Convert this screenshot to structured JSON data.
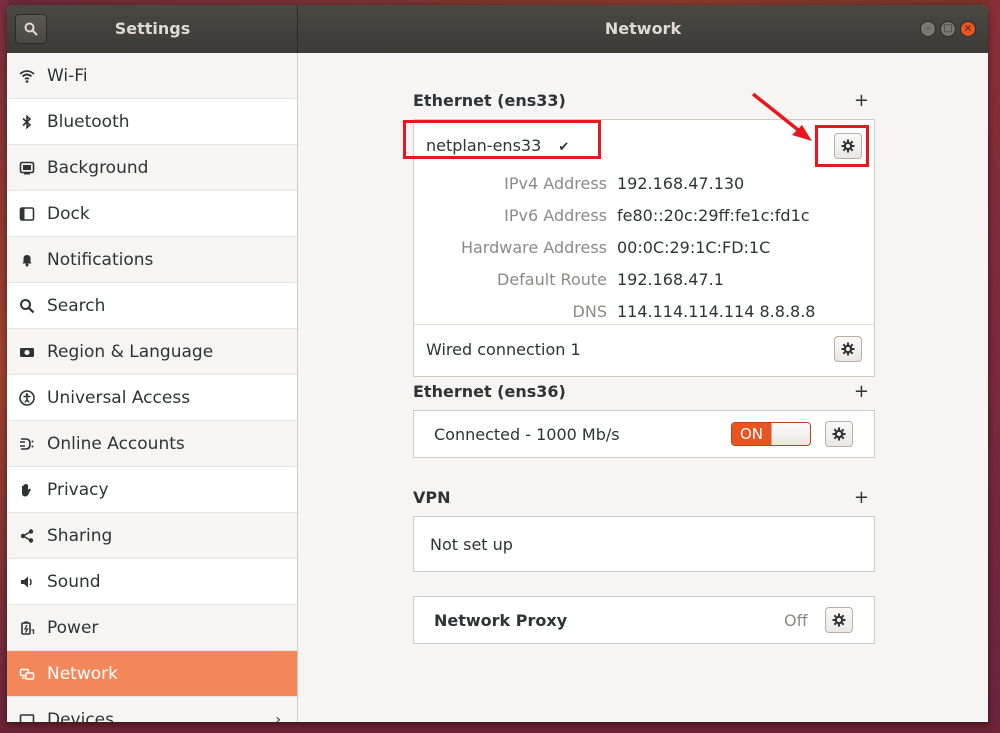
{
  "window": {
    "sidebar_title": "Settings",
    "main_title": "Network"
  },
  "sidebar": {
    "items": [
      {
        "label": "Wi-Fi",
        "icon": "wifi-icon"
      },
      {
        "label": "Bluetooth",
        "icon": "bluetooth-icon"
      },
      {
        "label": "Background",
        "icon": "background-icon"
      },
      {
        "label": "Dock",
        "icon": "dock-icon"
      },
      {
        "label": "Notifications",
        "icon": "bell-icon"
      },
      {
        "label": "Search",
        "icon": "search-icon"
      },
      {
        "label": "Region & Language",
        "icon": "camera-icon"
      },
      {
        "label": "Universal Access",
        "icon": "accessibility-icon"
      },
      {
        "label": "Online Accounts",
        "icon": "online-accounts-icon"
      },
      {
        "label": "Privacy",
        "icon": "hand-icon"
      },
      {
        "label": "Sharing",
        "icon": "share-icon"
      },
      {
        "label": "Sound",
        "icon": "speaker-icon"
      },
      {
        "label": "Power",
        "icon": "power-icon"
      },
      {
        "label": "Network",
        "icon": "network-icon",
        "active": true
      },
      {
        "label": "Devices",
        "icon": "devices-icon"
      }
    ]
  },
  "ethernet1": {
    "title": "Ethernet (ens33)",
    "profile_name": "netplan-ens33",
    "check": "✔",
    "details": [
      {
        "key": "IPv4 Address",
        "value": "192.168.47.130"
      },
      {
        "key": "IPv6 Address",
        "value": "fe80::20c:29ff:fe1c:fd1c"
      },
      {
        "key": "Hardware Address",
        "value": "00:0C:29:1C:FD:1C"
      },
      {
        "key": "Default Route",
        "value": "192.168.47.1"
      },
      {
        "key": "DNS",
        "value": "114.114.114.114 8.8.8.8"
      }
    ],
    "other_profile": "Wired connection 1"
  },
  "ethernet2": {
    "title": "Ethernet (ens36)",
    "status": "Connected - 1000 Mb/s",
    "toggle_label": "ON"
  },
  "vpn": {
    "title": "VPN",
    "status": "Not set up"
  },
  "proxy": {
    "label": "Network Proxy",
    "status": "Off"
  },
  "colors": {
    "accent": "#e95420",
    "active_item": "#f2875a",
    "annotation": "#e8171e"
  }
}
